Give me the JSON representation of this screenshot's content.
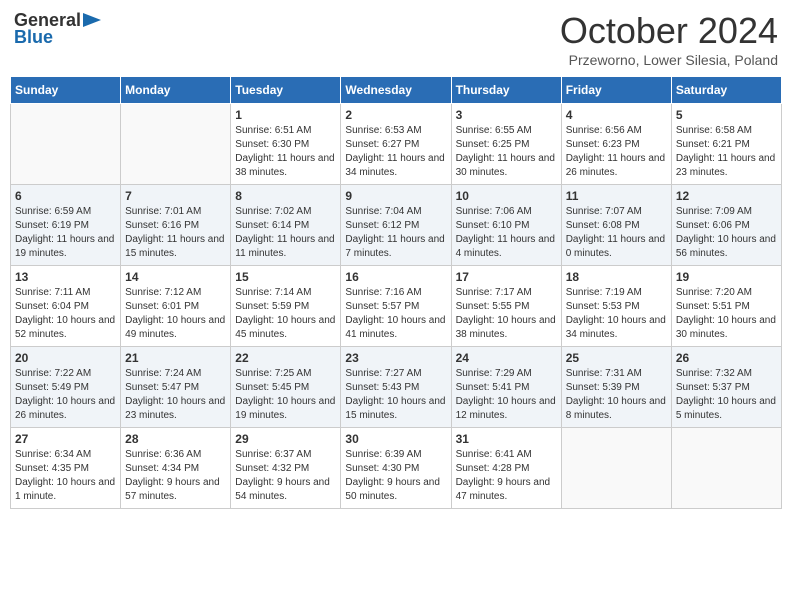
{
  "logo": {
    "general": "General",
    "blue": "Blue"
  },
  "title": "October 2024",
  "location": "Przeworno, Lower Silesia, Poland",
  "weekdays": [
    "Sunday",
    "Monday",
    "Tuesday",
    "Wednesday",
    "Thursday",
    "Friday",
    "Saturday"
  ],
  "weeks": [
    [
      {
        "day": "",
        "sunrise": "",
        "sunset": "",
        "daylight": ""
      },
      {
        "day": "",
        "sunrise": "",
        "sunset": "",
        "daylight": ""
      },
      {
        "day": "1",
        "sunrise": "Sunrise: 6:51 AM",
        "sunset": "Sunset: 6:30 PM",
        "daylight": "Daylight: 11 hours and 38 minutes."
      },
      {
        "day": "2",
        "sunrise": "Sunrise: 6:53 AM",
        "sunset": "Sunset: 6:27 PM",
        "daylight": "Daylight: 11 hours and 34 minutes."
      },
      {
        "day": "3",
        "sunrise": "Sunrise: 6:55 AM",
        "sunset": "Sunset: 6:25 PM",
        "daylight": "Daylight: 11 hours and 30 minutes."
      },
      {
        "day": "4",
        "sunrise": "Sunrise: 6:56 AM",
        "sunset": "Sunset: 6:23 PM",
        "daylight": "Daylight: 11 hours and 26 minutes."
      },
      {
        "day": "5",
        "sunrise": "Sunrise: 6:58 AM",
        "sunset": "Sunset: 6:21 PM",
        "daylight": "Daylight: 11 hours and 23 minutes."
      }
    ],
    [
      {
        "day": "6",
        "sunrise": "Sunrise: 6:59 AM",
        "sunset": "Sunset: 6:19 PM",
        "daylight": "Daylight: 11 hours and 19 minutes."
      },
      {
        "day": "7",
        "sunrise": "Sunrise: 7:01 AM",
        "sunset": "Sunset: 6:16 PM",
        "daylight": "Daylight: 11 hours and 15 minutes."
      },
      {
        "day": "8",
        "sunrise": "Sunrise: 7:02 AM",
        "sunset": "Sunset: 6:14 PM",
        "daylight": "Daylight: 11 hours and 11 minutes."
      },
      {
        "day": "9",
        "sunrise": "Sunrise: 7:04 AM",
        "sunset": "Sunset: 6:12 PM",
        "daylight": "Daylight: 11 hours and 7 minutes."
      },
      {
        "day": "10",
        "sunrise": "Sunrise: 7:06 AM",
        "sunset": "Sunset: 6:10 PM",
        "daylight": "Daylight: 11 hours and 4 minutes."
      },
      {
        "day": "11",
        "sunrise": "Sunrise: 7:07 AM",
        "sunset": "Sunset: 6:08 PM",
        "daylight": "Daylight: 11 hours and 0 minutes."
      },
      {
        "day": "12",
        "sunrise": "Sunrise: 7:09 AM",
        "sunset": "Sunset: 6:06 PM",
        "daylight": "Daylight: 10 hours and 56 minutes."
      }
    ],
    [
      {
        "day": "13",
        "sunrise": "Sunrise: 7:11 AM",
        "sunset": "Sunset: 6:04 PM",
        "daylight": "Daylight: 10 hours and 52 minutes."
      },
      {
        "day": "14",
        "sunrise": "Sunrise: 7:12 AM",
        "sunset": "Sunset: 6:01 PM",
        "daylight": "Daylight: 10 hours and 49 minutes."
      },
      {
        "day": "15",
        "sunrise": "Sunrise: 7:14 AM",
        "sunset": "Sunset: 5:59 PM",
        "daylight": "Daylight: 10 hours and 45 minutes."
      },
      {
        "day": "16",
        "sunrise": "Sunrise: 7:16 AM",
        "sunset": "Sunset: 5:57 PM",
        "daylight": "Daylight: 10 hours and 41 minutes."
      },
      {
        "day": "17",
        "sunrise": "Sunrise: 7:17 AM",
        "sunset": "Sunset: 5:55 PM",
        "daylight": "Daylight: 10 hours and 38 minutes."
      },
      {
        "day": "18",
        "sunrise": "Sunrise: 7:19 AM",
        "sunset": "Sunset: 5:53 PM",
        "daylight": "Daylight: 10 hours and 34 minutes."
      },
      {
        "day": "19",
        "sunrise": "Sunrise: 7:20 AM",
        "sunset": "Sunset: 5:51 PM",
        "daylight": "Daylight: 10 hours and 30 minutes."
      }
    ],
    [
      {
        "day": "20",
        "sunrise": "Sunrise: 7:22 AM",
        "sunset": "Sunset: 5:49 PM",
        "daylight": "Daylight: 10 hours and 26 minutes."
      },
      {
        "day": "21",
        "sunrise": "Sunrise: 7:24 AM",
        "sunset": "Sunset: 5:47 PM",
        "daylight": "Daylight: 10 hours and 23 minutes."
      },
      {
        "day": "22",
        "sunrise": "Sunrise: 7:25 AM",
        "sunset": "Sunset: 5:45 PM",
        "daylight": "Daylight: 10 hours and 19 minutes."
      },
      {
        "day": "23",
        "sunrise": "Sunrise: 7:27 AM",
        "sunset": "Sunset: 5:43 PM",
        "daylight": "Daylight: 10 hours and 15 minutes."
      },
      {
        "day": "24",
        "sunrise": "Sunrise: 7:29 AM",
        "sunset": "Sunset: 5:41 PM",
        "daylight": "Daylight: 10 hours and 12 minutes."
      },
      {
        "day": "25",
        "sunrise": "Sunrise: 7:31 AM",
        "sunset": "Sunset: 5:39 PM",
        "daylight": "Daylight: 10 hours and 8 minutes."
      },
      {
        "day": "26",
        "sunrise": "Sunrise: 7:32 AM",
        "sunset": "Sunset: 5:37 PM",
        "daylight": "Daylight: 10 hours and 5 minutes."
      }
    ],
    [
      {
        "day": "27",
        "sunrise": "Sunrise: 6:34 AM",
        "sunset": "Sunset: 4:35 PM",
        "daylight": "Daylight: 10 hours and 1 minute."
      },
      {
        "day": "28",
        "sunrise": "Sunrise: 6:36 AM",
        "sunset": "Sunset: 4:34 PM",
        "daylight": "Daylight: 9 hours and 57 minutes."
      },
      {
        "day": "29",
        "sunrise": "Sunrise: 6:37 AM",
        "sunset": "Sunset: 4:32 PM",
        "daylight": "Daylight: 9 hours and 54 minutes."
      },
      {
        "day": "30",
        "sunrise": "Sunrise: 6:39 AM",
        "sunset": "Sunset: 4:30 PM",
        "daylight": "Daylight: 9 hours and 50 minutes."
      },
      {
        "day": "31",
        "sunrise": "Sunrise: 6:41 AM",
        "sunset": "Sunset: 4:28 PM",
        "daylight": "Daylight: 9 hours and 47 minutes."
      },
      {
        "day": "",
        "sunrise": "",
        "sunset": "",
        "daylight": ""
      },
      {
        "day": "",
        "sunrise": "",
        "sunset": "",
        "daylight": ""
      }
    ]
  ]
}
